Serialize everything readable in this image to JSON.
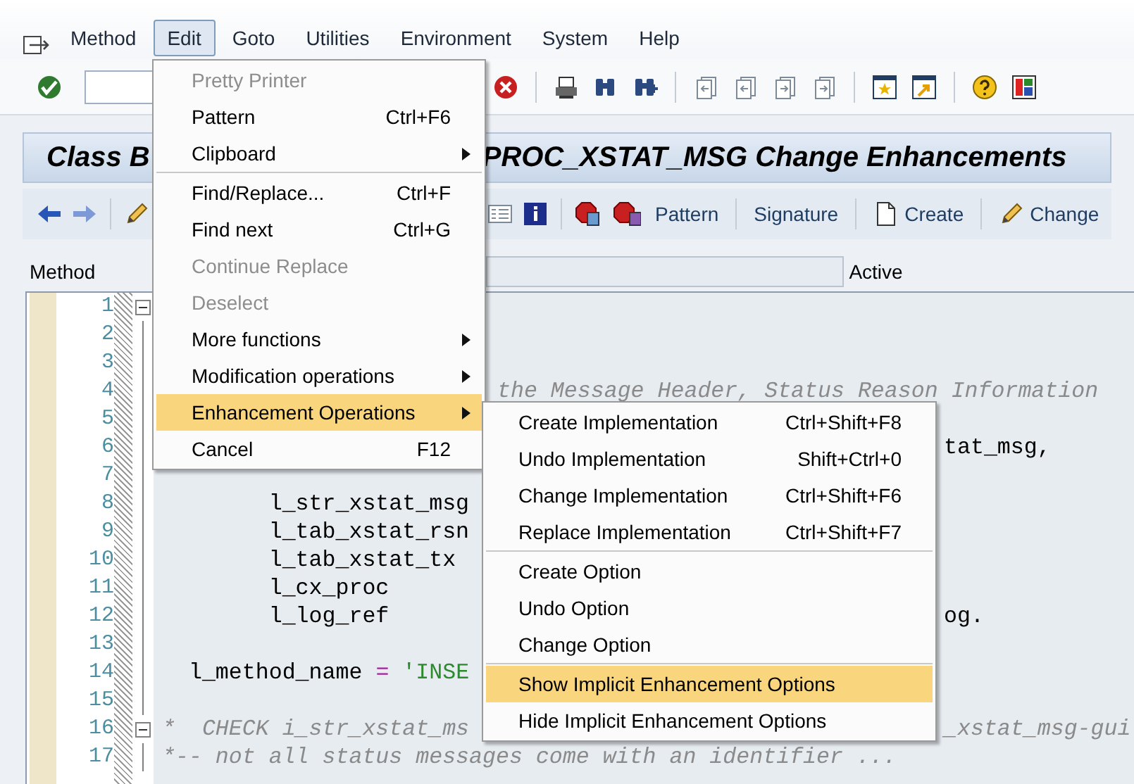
{
  "menu_bar": {
    "items": [
      {
        "label": "Method",
        "selected": false
      },
      {
        "label": "Edit",
        "selected": true
      },
      {
        "label": "Goto",
        "selected": false
      },
      {
        "label": "Utilities",
        "selected": false
      },
      {
        "label": "Environment",
        "selected": false
      },
      {
        "label": "System",
        "selected": false
      },
      {
        "label": "Help",
        "selected": false
      }
    ]
  },
  "title": {
    "parts": [
      "Class B",
      "PROC_XSTAT_MSG Change Enhancements"
    ]
  },
  "app_toolbar": {
    "buttons": [
      {
        "label": "Pattern",
        "kind": "text"
      },
      {
        "label": "Signature",
        "kind": "text"
      },
      {
        "label": "Create",
        "kind": "document"
      },
      {
        "label": "Change",
        "kind": "pencil"
      }
    ]
  },
  "method_row": {
    "label": "Method",
    "status": "Active"
  },
  "editor": {
    "lines": [
      {
        "number": "1",
        "fold": true
      },
      {
        "number": "2",
        "fold": false
      },
      {
        "number": "3",
        "fold": false
      },
      {
        "number": "4",
        "fold": false,
        "mid": [
          {
            "kind": "comment",
            "text": "the Message Header, Status Reason Information"
          }
        ]
      },
      {
        "number": "5",
        "fold": false
      },
      {
        "number": "6",
        "fold": false,
        "tail": [
          {
            "kind": "plain",
            "text": "tat_msg,"
          }
        ]
      },
      {
        "number": "7",
        "fold": false
      },
      {
        "number": "8",
        "fold": false,
        "text": [
          {
            "kind": "plain",
            "text": "        l_str_xstat_msg"
          }
        ]
      },
      {
        "number": "9",
        "fold": false,
        "text": [
          {
            "kind": "plain",
            "text": "        l_tab_xstat_rsn"
          }
        ]
      },
      {
        "number": "10",
        "fold": false,
        "text": [
          {
            "kind": "plain",
            "text": "        l_tab_xstat_tx"
          }
        ]
      },
      {
        "number": "11",
        "fold": false,
        "text": [
          {
            "kind": "plain",
            "text": "        l_cx_proc"
          }
        ]
      },
      {
        "number": "12",
        "fold": false,
        "text": [
          {
            "kind": "plain",
            "text": "        l_log_ref"
          }
        ],
        "tail": [
          {
            "kind": "plain",
            "text": "og."
          }
        ]
      },
      {
        "number": "13",
        "fold": false
      },
      {
        "number": "14",
        "fold": false,
        "text": [
          {
            "kind": "plain",
            "text": "  l_method_name "
          },
          {
            "kind": "operator",
            "text": "="
          },
          {
            "kind": "string",
            "text": " 'INSE"
          }
        ]
      },
      {
        "number": "15",
        "fold": false
      },
      {
        "number": "16",
        "fold": true,
        "text": [
          {
            "kind": "comment",
            "text": "*  CHECK i_str_xstat_ms"
          }
        ],
        "tail": [
          {
            "kind": "comment",
            "text": "_xstat_msg-gui"
          }
        ]
      },
      {
        "number": "17",
        "fold": false,
        "text": [
          {
            "kind": "comment",
            "text": "*-- not all status messages come with an identifier ..."
          }
        ]
      }
    ]
  },
  "edit_menu": {
    "groups": [
      {
        "items": [
          {
            "label": "Pretty Printer",
            "disabled": true,
            "selected": false,
            "has_submenu": false
          },
          {
            "label": "Pattern",
            "shortcut": "Ctrl+F6",
            "disabled": false,
            "selected": false,
            "has_submenu": false
          },
          {
            "label": "Clipboard",
            "disabled": false,
            "selected": false,
            "has_submenu": true
          }
        ]
      },
      {
        "items": [
          {
            "label": "Find/Replace...",
            "shortcut": "Ctrl+F",
            "disabled": false,
            "selected": false,
            "has_submenu": false
          },
          {
            "label": "Find next",
            "shortcut": "Ctrl+G",
            "disabled": false,
            "selected": false,
            "has_submenu": false
          },
          {
            "label": "Continue Replace",
            "disabled": true,
            "selected": false,
            "has_submenu": false
          },
          {
            "label": "Deselect",
            "disabled": true,
            "selected": false,
            "has_submenu": false
          },
          {
            "label": "More functions",
            "disabled": false,
            "selected": false,
            "has_submenu": true
          },
          {
            "label": "Modification operations",
            "disabled": false,
            "selected": false,
            "has_submenu": true
          },
          {
            "label": "Enhancement Operations",
            "disabled": false,
            "selected": true,
            "has_submenu": true
          },
          {
            "label": "Cancel",
            "shortcut": "F12",
            "disabled": false,
            "selected": false,
            "has_submenu": false
          }
        ]
      }
    ]
  },
  "submenu": {
    "groups": [
      {
        "items": [
          {
            "label": "Create Implementation",
            "shortcut": "Ctrl+Shift+F8",
            "disabled": false,
            "selected": false,
            "has_submenu": false
          },
          {
            "label": "Undo Implementation",
            "shortcut": "Shift+Ctrl+0",
            "disabled": false,
            "selected": false,
            "has_submenu": false
          },
          {
            "label": "Change Implementation",
            "shortcut": "Ctrl+Shift+F6",
            "disabled": false,
            "selected": false,
            "has_submenu": false
          },
          {
            "label": "Replace Implementation",
            "shortcut": "Ctrl+Shift+F7",
            "disabled": false,
            "selected": false,
            "has_submenu": false
          }
        ]
      },
      {
        "items": [
          {
            "label": "Create Option",
            "disabled": false,
            "selected": false,
            "has_submenu": false
          },
          {
            "label": "Undo Option",
            "disabled": false,
            "selected": false,
            "has_submenu": false
          },
          {
            "label": "Change Option",
            "disabled": false,
            "selected": false,
            "has_submenu": false
          }
        ]
      },
      {
        "items": [
          {
            "label": "Show Implicit Enhancement Options",
            "disabled": false,
            "selected": true,
            "has_submenu": false
          },
          {
            "label": "Hide Implicit Enhancement Options",
            "disabled": false,
            "selected": false,
            "has_submenu": false
          }
        ]
      }
    ]
  }
}
